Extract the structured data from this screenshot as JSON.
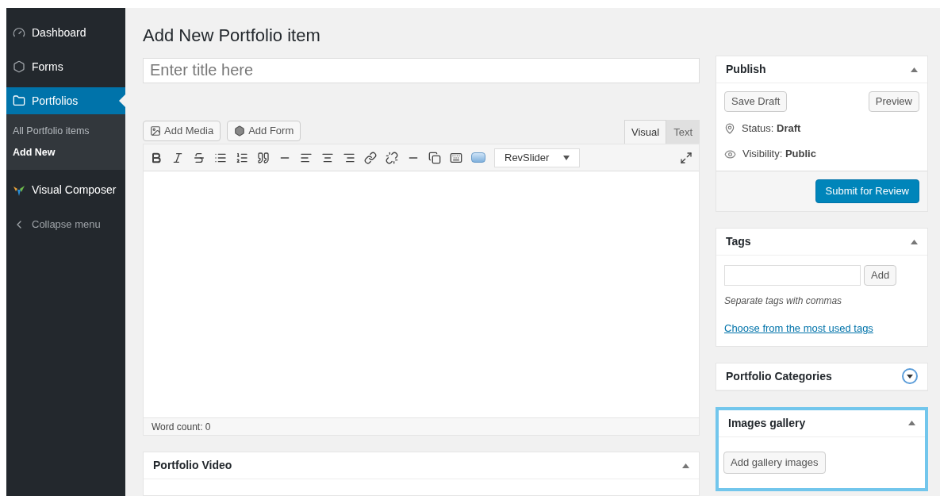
{
  "sidebar": {
    "items": [
      {
        "label": "Dashboard",
        "selected": false
      },
      {
        "label": "Forms",
        "selected": false
      },
      {
        "label": "Portfolios",
        "selected": true,
        "children": [
          {
            "label": "All Portfolio items",
            "selected": false
          },
          {
            "label": "Add New",
            "selected": true
          }
        ]
      },
      {
        "label": "Visual Composer",
        "selected": false
      },
      {
        "label": "Collapse menu",
        "selected": false
      }
    ]
  },
  "page_title": "Add New Portfolio item",
  "title_field": {
    "placeholder": "Enter title here"
  },
  "editor": {
    "buttons": [
      {
        "label": "Add Media"
      },
      {
        "label": "Add Form"
      }
    ],
    "tabs": [
      {
        "label": "Visual",
        "selected": true
      },
      {
        "label": "Text",
        "selected": false
      }
    ],
    "dropdown": "RevSlider",
    "word_count": "Word count: 0"
  },
  "portfolio_video": {
    "title": "Portfolio Video"
  },
  "publish": {
    "title": "Publish",
    "save_draft": "Save Draft",
    "preview": "Preview",
    "status": "Status: **Draft**",
    "visibility": "Visibility: **Public**",
    "submit": "Submit for Review"
  },
  "tags": {
    "title": "Tags",
    "add": "Add",
    "hint": "Separate tags with commas",
    "link": "Choose from the most used tags"
  },
  "categories": {
    "title": "Portfolio Categories",
    "expanded": false
  },
  "gallery": {
    "title": "Images gallery",
    "button": "Add gallery images",
    "highlighted": true
  }
}
